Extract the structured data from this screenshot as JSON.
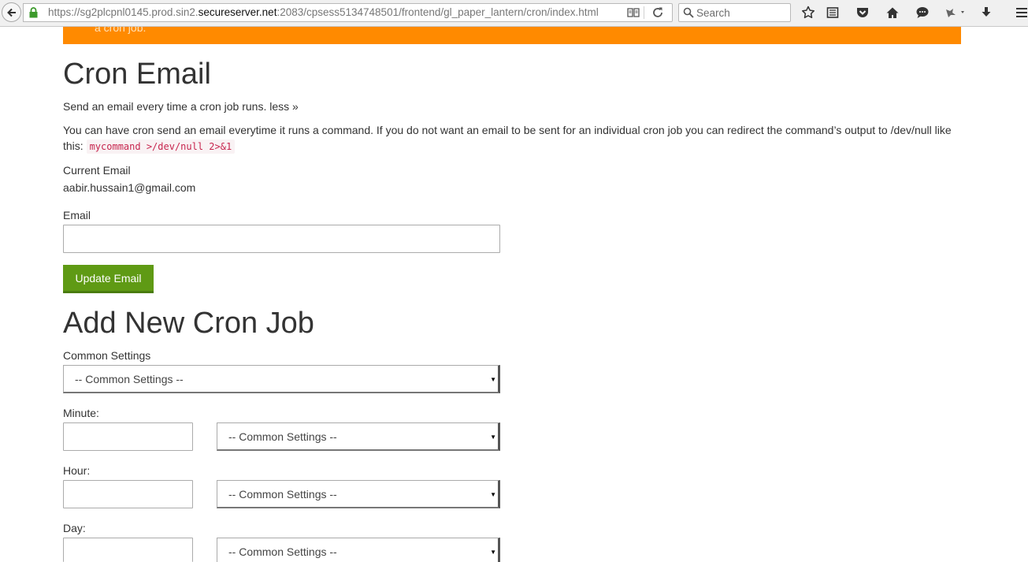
{
  "browser": {
    "url_prefix": "https://sg2plcpnl0145.prod.sin2.",
    "url_domain": "secureserver.net",
    "url_rest": ":2083/cpsess5134748501/frontend/gl_paper_lantern/cron/index.html",
    "search_placeholder": "Search"
  },
  "banner": {
    "text": "a cron job."
  },
  "cron_email": {
    "title": "Cron Email",
    "intro": "Send an email every time a cron job runs.",
    "toggle_link": "less »",
    "description": "You can have cron send an email everytime it runs a command. If you do not want an email to be sent for an individual cron job you can redirect the command’s output to /dev/null like this:",
    "example_code": "mycommand >/dev/null 2>&1",
    "current_email_label": "Current Email",
    "current_email_value": "aabir.hussain1@gmail.com",
    "email_label": "Email",
    "email_value": "",
    "update_button": "Update Email"
  },
  "add_cron": {
    "title": "Add New Cron Job",
    "common_settings_label": "Common Settings",
    "common_settings_value": "-- Common Settings --",
    "minute_label": "Minute:",
    "minute_value": "",
    "minute_select": "-- Common Settings --",
    "hour_label": "Hour:",
    "hour_value": "",
    "hour_select": "-- Common Settings --",
    "day_label": "Day:",
    "day_value": "",
    "day_select": "-- Common Settings --"
  },
  "colors": {
    "banner": "#ff8a00",
    "button": "#5f9a14",
    "code_text": "#c7254e"
  },
  "icons": [
    "back-icon",
    "lock-icon",
    "reader-view-icon",
    "reload-icon",
    "search-icon",
    "bookmark-star-icon",
    "reading-list-icon",
    "pocket-icon",
    "home-icon",
    "chat-icon",
    "extension-icon",
    "download-icon",
    "menu-icon"
  ]
}
